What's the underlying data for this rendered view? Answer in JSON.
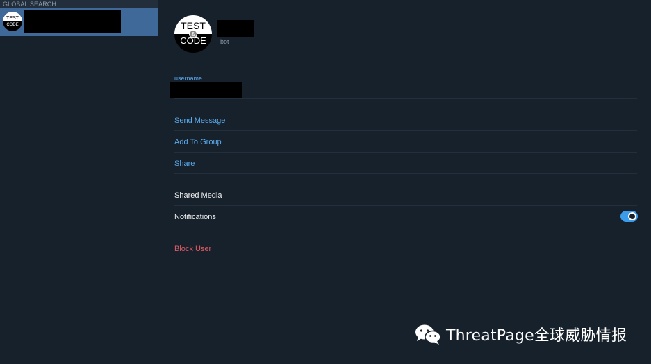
{
  "sidebar": {
    "section_header": "GLOBAL SEARCH",
    "results": [
      {
        "avatar_top": "TEST",
        "avatar_bottom": "CODE"
      }
    ]
  },
  "profile": {
    "avatar_top": "TEST",
    "avatar_amp": "&",
    "avatar_bottom": "CODE",
    "subtitle": "bot",
    "username_label": "username"
  },
  "actions": {
    "send_message": "Send Message",
    "add_to_group": "Add To Group",
    "share": "Share"
  },
  "settings": {
    "shared_media": "Shared Media",
    "notifications": "Notifications",
    "notifications_enabled": true
  },
  "danger": {
    "block_user": "Block User"
  },
  "watermark": {
    "text": "ThreatPage全球威胁情报"
  },
  "colors": {
    "background": "#17212b",
    "selected_row": "#3e6998",
    "link": "#5aa9ec",
    "danger": "#e15b64",
    "toggle_on": "#3b9cec"
  }
}
